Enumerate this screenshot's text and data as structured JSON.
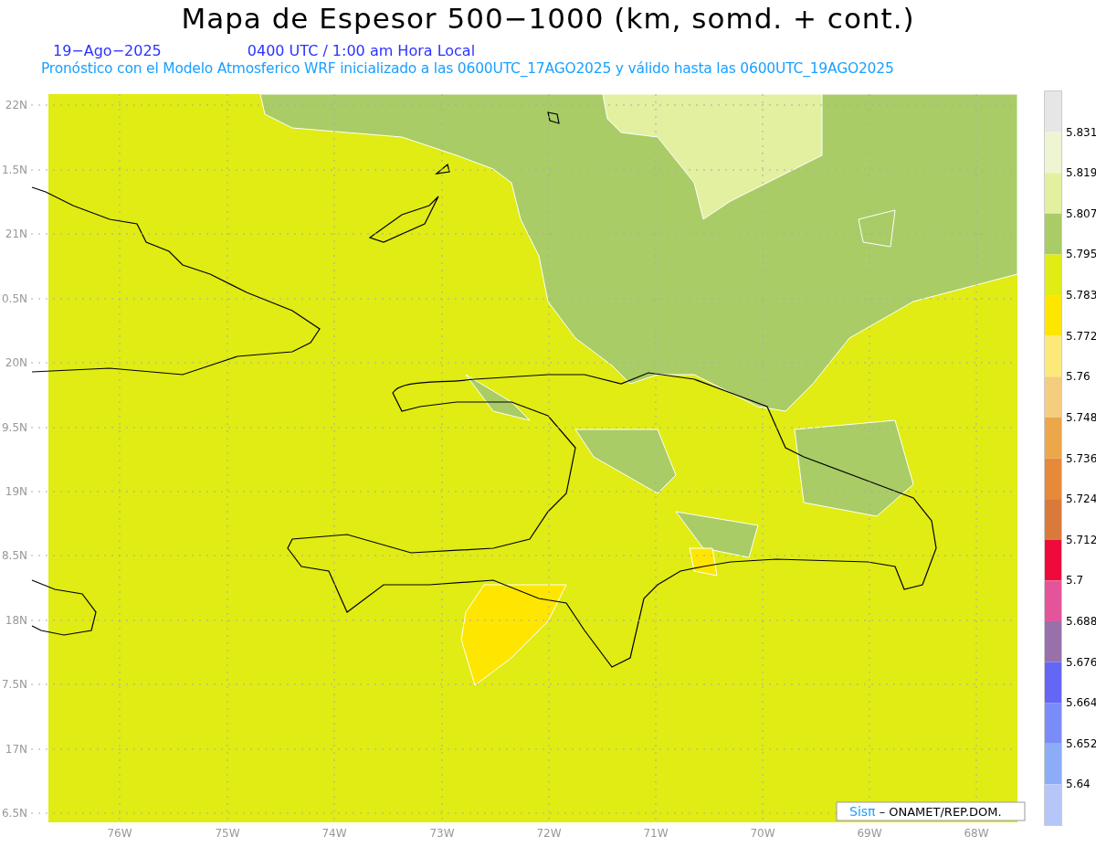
{
  "title": "Mapa de Espesor 500−1000 (km, somd. + cont.)",
  "date": "19−Ago−2025",
  "time": "0400 UTC / 1:00 am Hora Local",
  "subtitle": "Pronóstico con el Modelo Atmosferico WRF inicializado a las 0600UTC_17AGO2025 y válido hasta las  0600UTC_19AGO2025",
  "map": {
    "lat_labels": [
      "22N",
      "1.5N",
      "21N",
      "0.5N",
      "20N",
      "9.5N",
      "19N",
      "8.5N",
      "18N",
      "7.5N",
      "17N",
      "6.5N"
    ],
    "lon_labels": [
      "76W",
      "75W",
      "74W",
      "73W",
      "72W",
      "71W",
      "70W",
      "69W",
      "68W"
    ]
  },
  "legend": [
    {
      "color": "#e6e6e6",
      "label": "5.831"
    },
    {
      "color": "#eef5d2",
      "label": "5.819"
    },
    {
      "color": "#e3f0a0",
      "label": "5.807"
    },
    {
      "color": "#a9cc66",
      "label": "5.795"
    },
    {
      "color": "#e0ec14",
      "label": "5.783"
    },
    {
      "color": "#fee600",
      "label": "5.772"
    },
    {
      "color": "#fde97a",
      "label": "5.76"
    },
    {
      "color": "#f4cd7f",
      "label": "5.748"
    },
    {
      "color": "#eba74a",
      "label": "5.736"
    },
    {
      "color": "#e68a3a",
      "label": "5.724"
    },
    {
      "color": "#d97a3a",
      "label": "5.712"
    },
    {
      "color": "#ef0a3c",
      "label": "5.7"
    },
    {
      "color": "#e4549a",
      "label": "5.688"
    },
    {
      "color": "#9870aa",
      "label": "5.676"
    },
    {
      "color": "#6466f6",
      "label": "5.664"
    },
    {
      "color": "#7a8cf8",
      "label": "5.652"
    },
    {
      "color": "#8cacf8",
      "label": "5.64"
    },
    {
      "color": "#b6c6f8"
    }
  ],
  "credit": {
    "brand": "Sisπ",
    "text": "– ONAMET/REP.DOM."
  }
}
